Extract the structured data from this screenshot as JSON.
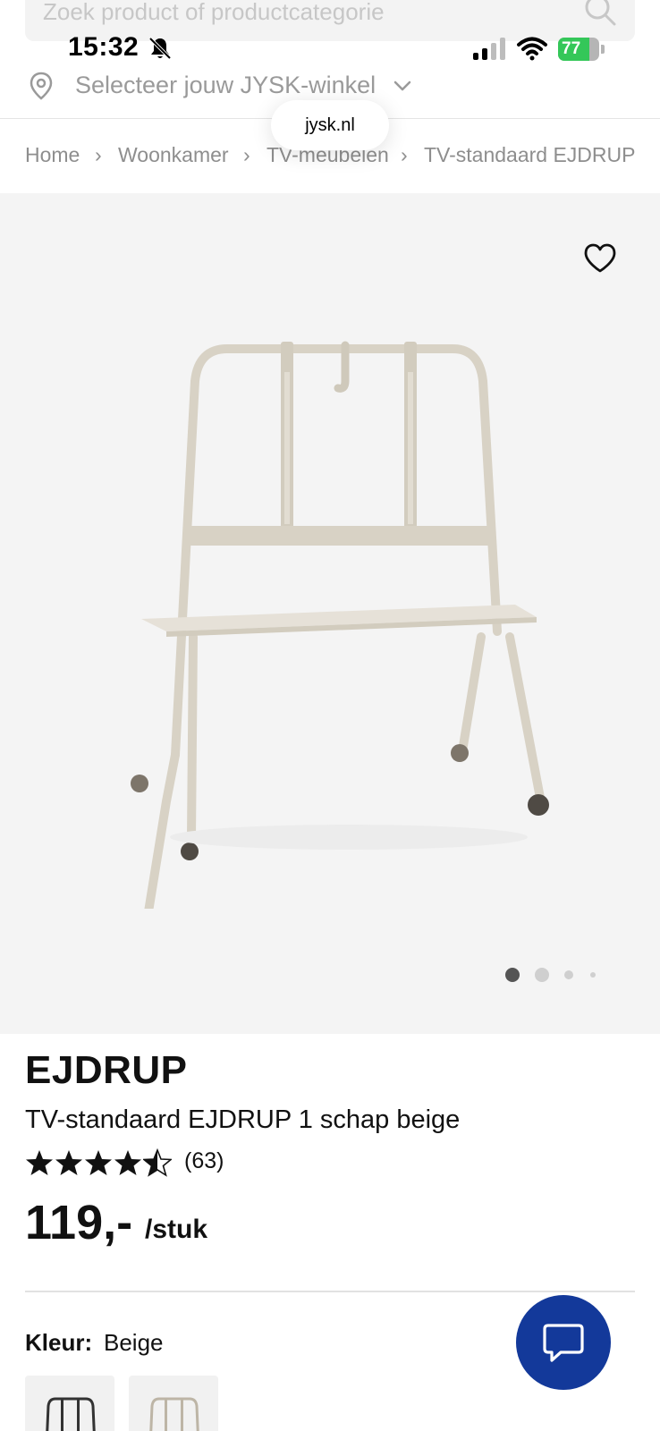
{
  "status_bar": {
    "time": "15:32",
    "battery": "77",
    "battery_level": 0.77
  },
  "search": {
    "placeholder": "Zoek product of productcategorie"
  },
  "store_selector": {
    "label": "Selecteer jouw JYSK-winkel"
  },
  "browser": {
    "url": "jysk.nl"
  },
  "breadcrumb": {
    "items": [
      "Home",
      "Woonkamer",
      "TV-meubelen",
      "TV-standaard EJDRUP"
    ],
    "separator": "›"
  },
  "gallery": {
    "dot_count": 4,
    "active_index": 0
  },
  "product": {
    "brand": "EJDRUP",
    "name": "TV-standaard EJDRUP 1 schap beige",
    "rating": 4.5,
    "rating_count": "(63)",
    "price": "119,-",
    "price_unit": "/stuk",
    "color_label": "Kleur:",
    "color_value": "Beige"
  },
  "colors": {
    "accent": "#13399a",
    "battery_green": "#34c759",
    "image_background": "#f4f4f4",
    "product_beige": "#d8d2c5"
  },
  "icons": {
    "search": "search-icon",
    "bell_slash": "bell-slash-icon",
    "signal": "signal-icon",
    "wifi": "wifi-icon",
    "pin": "location-pin-icon",
    "chevron": "chevron-down-icon",
    "heart": "heart-icon",
    "chat": "chat-bubble-icon",
    "star": "star-icon"
  }
}
